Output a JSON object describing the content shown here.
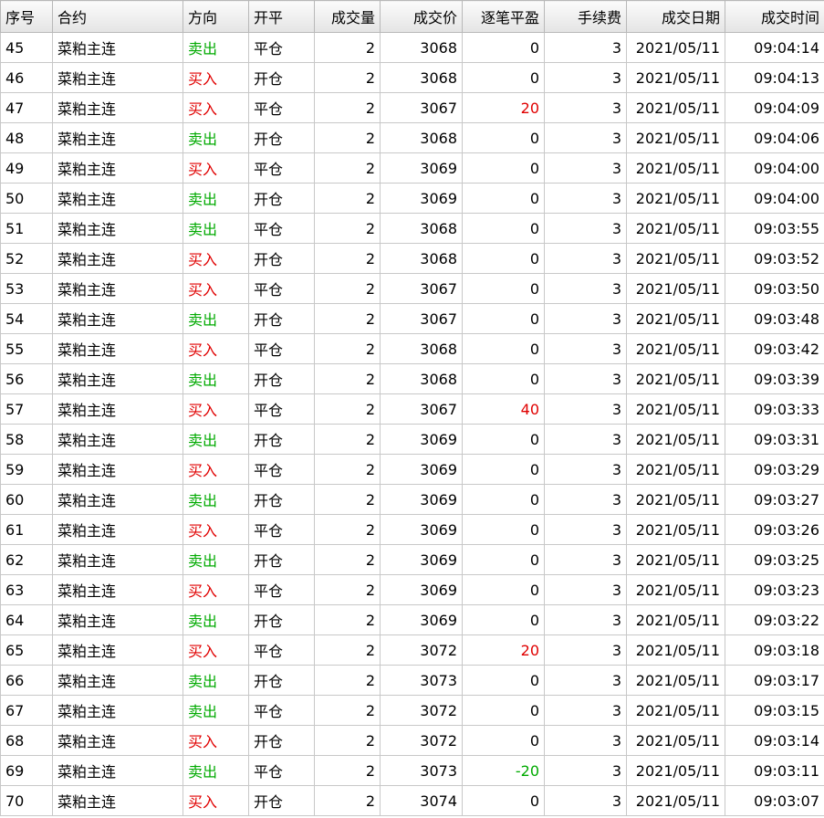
{
  "colors": {
    "sell": "#00aa00",
    "buy": "#e00000",
    "profit": "#e00000",
    "loss": "#00aa00",
    "neutral": "#000000"
  },
  "table": {
    "headers": [
      "序号",
      "合约",
      "方向",
      "开平",
      "成交量",
      "成交价",
      "逐笔平盈",
      "手续费",
      "成交日期",
      "成交时间"
    ],
    "rows": [
      [
        "45",
        "菜粕主连",
        "卖出",
        "平仓",
        "2",
        "3068",
        "0",
        "3",
        "2021/05/11",
        "09:04:14"
      ],
      [
        "46",
        "菜粕主连",
        "买入",
        "开仓",
        "2",
        "3068",
        "0",
        "3",
        "2021/05/11",
        "09:04:13"
      ],
      [
        "47",
        "菜粕主连",
        "买入",
        "平仓",
        "2",
        "3067",
        "20",
        "3",
        "2021/05/11",
        "09:04:09"
      ],
      [
        "48",
        "菜粕主连",
        "卖出",
        "开仓",
        "2",
        "3068",
        "0",
        "3",
        "2021/05/11",
        "09:04:06"
      ],
      [
        "49",
        "菜粕主连",
        "买入",
        "平仓",
        "2",
        "3069",
        "0",
        "3",
        "2021/05/11",
        "09:04:00"
      ],
      [
        "50",
        "菜粕主连",
        "卖出",
        "开仓",
        "2",
        "3069",
        "0",
        "3",
        "2021/05/11",
        "09:04:00"
      ],
      [
        "51",
        "菜粕主连",
        "卖出",
        "平仓",
        "2",
        "3068",
        "0",
        "3",
        "2021/05/11",
        "09:03:55"
      ],
      [
        "52",
        "菜粕主连",
        "买入",
        "开仓",
        "2",
        "3068",
        "0",
        "3",
        "2021/05/11",
        "09:03:52"
      ],
      [
        "53",
        "菜粕主连",
        "买入",
        "平仓",
        "2",
        "3067",
        "0",
        "3",
        "2021/05/11",
        "09:03:50"
      ],
      [
        "54",
        "菜粕主连",
        "卖出",
        "开仓",
        "2",
        "3067",
        "0",
        "3",
        "2021/05/11",
        "09:03:48"
      ],
      [
        "55",
        "菜粕主连",
        "买入",
        "平仓",
        "2",
        "3068",
        "0",
        "3",
        "2021/05/11",
        "09:03:42"
      ],
      [
        "56",
        "菜粕主连",
        "卖出",
        "开仓",
        "2",
        "3068",
        "0",
        "3",
        "2021/05/11",
        "09:03:39"
      ],
      [
        "57",
        "菜粕主连",
        "买入",
        "平仓",
        "2",
        "3067",
        "40",
        "3",
        "2021/05/11",
        "09:03:33"
      ],
      [
        "58",
        "菜粕主连",
        "卖出",
        "开仓",
        "2",
        "3069",
        "0",
        "3",
        "2021/05/11",
        "09:03:31"
      ],
      [
        "59",
        "菜粕主连",
        "买入",
        "平仓",
        "2",
        "3069",
        "0",
        "3",
        "2021/05/11",
        "09:03:29"
      ],
      [
        "60",
        "菜粕主连",
        "卖出",
        "开仓",
        "2",
        "3069",
        "0",
        "3",
        "2021/05/11",
        "09:03:27"
      ],
      [
        "61",
        "菜粕主连",
        "买入",
        "平仓",
        "2",
        "3069",
        "0",
        "3",
        "2021/05/11",
        "09:03:26"
      ],
      [
        "62",
        "菜粕主连",
        "卖出",
        "开仓",
        "2",
        "3069",
        "0",
        "3",
        "2021/05/11",
        "09:03:25"
      ],
      [
        "63",
        "菜粕主连",
        "买入",
        "平仓",
        "2",
        "3069",
        "0",
        "3",
        "2021/05/11",
        "09:03:23"
      ],
      [
        "64",
        "菜粕主连",
        "卖出",
        "开仓",
        "2",
        "3069",
        "0",
        "3",
        "2021/05/11",
        "09:03:22"
      ],
      [
        "65",
        "菜粕主连",
        "买入",
        "平仓",
        "2",
        "3072",
        "20",
        "3",
        "2021/05/11",
        "09:03:18"
      ],
      [
        "66",
        "菜粕主连",
        "卖出",
        "开仓",
        "2",
        "3073",
        "0",
        "3",
        "2021/05/11",
        "09:03:17"
      ],
      [
        "67",
        "菜粕主连",
        "卖出",
        "平仓",
        "2",
        "3072",
        "0",
        "3",
        "2021/05/11",
        "09:03:15"
      ],
      [
        "68",
        "菜粕主连",
        "买入",
        "开仓",
        "2",
        "3072",
        "0",
        "3",
        "2021/05/11",
        "09:03:14"
      ],
      [
        "69",
        "菜粕主连",
        "卖出",
        "平仓",
        "2",
        "3073",
        "-20",
        "3",
        "2021/05/11",
        "09:03:11"
      ],
      [
        "70",
        "菜粕主连",
        "买入",
        "开仓",
        "2",
        "3074",
        "0",
        "3",
        "2021/05/11",
        "09:03:07"
      ]
    ]
  }
}
